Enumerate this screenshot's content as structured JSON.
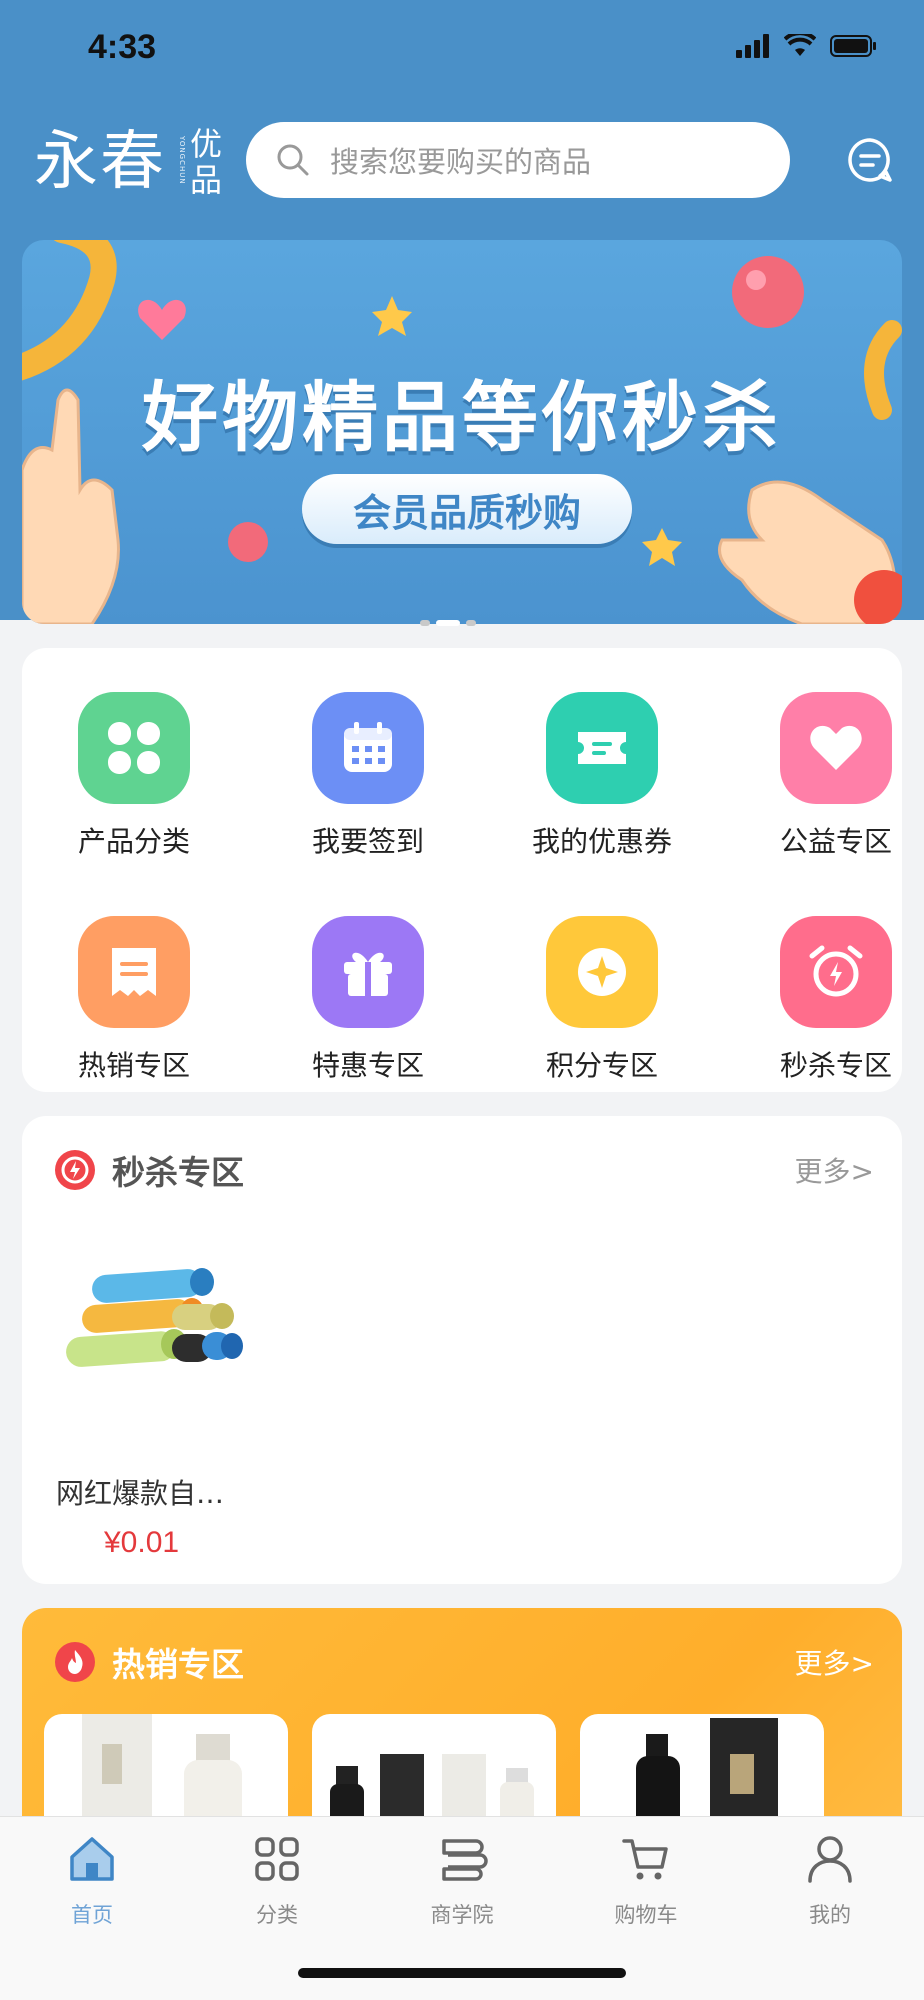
{
  "status_bar": {
    "time": "4:33"
  },
  "header": {
    "logo_main": "永春",
    "logo_sub": "优品",
    "logo_pinyin": "YONGCHUN",
    "search_placeholder": "搜索您要购买的商品"
  },
  "banner": {
    "title": "好物精品等你秒杀",
    "pill": "会员品质秒购",
    "page_count": 3,
    "active_page": 2
  },
  "grid": {
    "items": [
      {
        "label": "产品分类",
        "icon": "clover-icon",
        "color": "#5fd391"
      },
      {
        "label": "我要签到",
        "icon": "calendar-icon",
        "color": "#6c8ff5"
      },
      {
        "label": "我的优惠券",
        "icon": "ticket-icon",
        "color": "#2ecfb0"
      },
      {
        "label": "公益专区",
        "icon": "heart-icon",
        "color": "#ff7fa8"
      },
      {
        "label": "热销专区",
        "icon": "receipt-icon",
        "color": "#ff9e63"
      },
      {
        "label": "特惠专区",
        "icon": "gift-icon",
        "color": "#9c78f5"
      },
      {
        "label": "积分专区",
        "icon": "coin-icon",
        "color": "#ffc83a"
      },
      {
        "label": "秒杀专区",
        "icon": "alarm-icon",
        "color": "#ff6d8c"
      }
    ]
  },
  "flash_sale": {
    "title": "秒杀专区",
    "more": "更多>",
    "product": {
      "name": "网红爆款自…",
      "price": "¥0.01"
    }
  },
  "hot_sale": {
    "title": "热销专区",
    "more": "更多>"
  },
  "tabbar": {
    "tabs": [
      {
        "label": "首页",
        "icon": "home-icon",
        "active": true
      },
      {
        "label": "分类",
        "icon": "grid-icon",
        "active": false
      },
      {
        "label": "商学院",
        "icon": "academy-icon",
        "active": false
      },
      {
        "label": "购物车",
        "icon": "cart-icon",
        "active": false
      },
      {
        "label": "我的",
        "icon": "profile-icon",
        "active": false
      }
    ]
  },
  "colors": {
    "header_bg": "#4a90c8",
    "accent": "#6fa3d6",
    "price": "#e4393c",
    "hot_bg": "#ffb133"
  }
}
